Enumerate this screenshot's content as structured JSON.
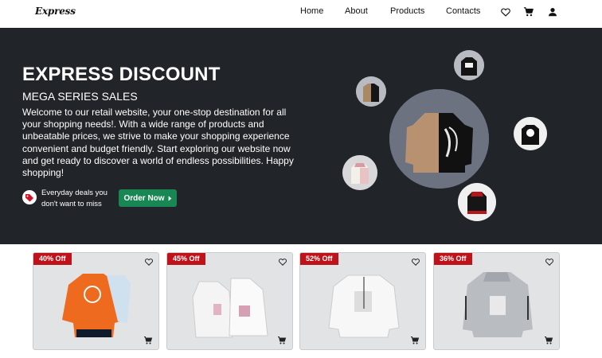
{
  "brand": {
    "name": "Express"
  },
  "nav": {
    "links": [
      "Home",
      "About",
      "Products",
      "Contacts"
    ],
    "icons": [
      "heart-icon",
      "cart-icon",
      "user-icon"
    ]
  },
  "hero": {
    "title": "EXPRESS DISCOUNT",
    "subtitle": "MEGA SERIES SALES",
    "description": "Welcome to our retail website, your one-stop destination for all your shopping needs!. With a wide range of products and unbeatable prices, we strive to make your shopping experience convenient and budget friendly. Start exploring our website now and get ready to discover a world of endless possibilities. Happy shopping!",
    "deal_text": "Everyday deals you don't want to miss",
    "order_button": "Order Now"
  },
  "products": [
    {
      "discount": "40% Off"
    },
    {
      "discount": "45% Off"
    },
    {
      "discount": "52% Off"
    },
    {
      "discount": "36% Off"
    }
  ],
  "colors": {
    "hero_bg": "#212428",
    "discount_badge": "#c0121b",
    "order_button": "#198754",
    "card_bg": "#e2e3e5"
  }
}
